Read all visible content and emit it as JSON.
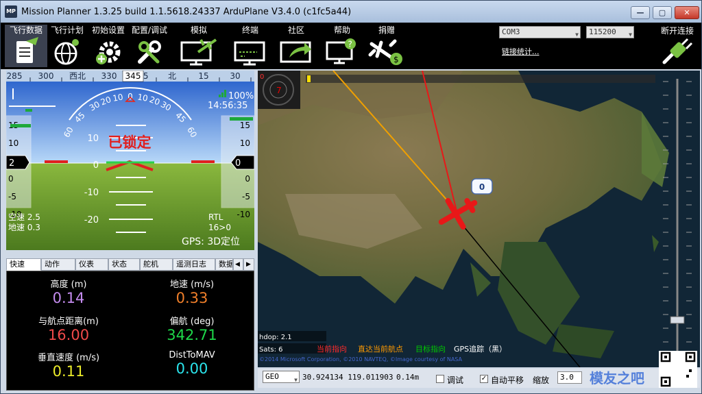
{
  "window": {
    "title": "Mission Planner 1.3.25 build 1.1.5618.24337 ArduPlane V3.4.0 (c1fc5a44)",
    "icon_text": "MP",
    "min": "—",
    "max": "▢",
    "close": "✕"
  },
  "toolbar": {
    "items": [
      {
        "label": "飞行数据",
        "icon": "flight-data-icon"
      },
      {
        "label": "飞行计划",
        "icon": "globe-icon"
      },
      {
        "label": "初始设置",
        "icon": "gear-add-icon"
      },
      {
        "label": "配置/调试",
        "icon": "wrench-icon"
      },
      {
        "label": "模拟",
        "icon": "monitor-plane-icon"
      },
      {
        "label": "终端",
        "icon": "terminal-icon"
      },
      {
        "label": "社区",
        "icon": "share-icon"
      },
      {
        "label": "帮助",
        "icon": "help-monitor-icon"
      },
      {
        "label": "捐赠",
        "icon": "donate-plane-icon"
      }
    ],
    "port": "COM3",
    "baud": "115200",
    "link_stats": "链接统计...",
    "disconnect": "断开连接"
  },
  "hud": {
    "heading_ticks": [
      "285",
      "300",
      "西北",
      "330",
      "345",
      "北",
      "15",
      "30"
    ],
    "heading_value": "345",
    "roll_ticks": [
      "60",
      "45",
      "30",
      "20",
      "10",
      "0",
      "10",
      "20",
      "30",
      "45",
      "60"
    ],
    "pitch_ticks": [
      "10",
      "0",
      "-10",
      "-20"
    ],
    "status": "已锁定",
    "battery": "100%",
    "time": "14:56:35",
    "left_tape": [
      "15",
      "10",
      "5",
      "0",
      "-5",
      "-10"
    ],
    "left_value": "2",
    "right_tape": [
      "15",
      "10",
      "5",
      "0",
      "-5",
      "-10"
    ],
    "right_value": "0",
    "airspeed": "空速 2.5",
    "groundspeed": "地速 0.3",
    "mode": "RTL",
    "wp": "16>0",
    "gps": "GPS: 3D定位",
    "sky_color": "#1a6bd0",
    "ground_color": "#6f9c2a"
  },
  "tabs": [
    "快速",
    "动作",
    "仪表",
    "状态",
    "舵机",
    "遥测日志",
    "数据"
  ],
  "tab_scroll": [
    "◀",
    "▶"
  ],
  "quick": [
    {
      "label": "高度 (m)",
      "value": "0.14",
      "color": "#c58cf0"
    },
    {
      "label": "地速 (m/s)",
      "value": "0.33",
      "color": "#f07f2a"
    },
    {
      "label": "与航点距离(m)",
      "value": "16.00",
      "color": "#f04a4a"
    },
    {
      "label": "偏航 (deg)",
      "value": "342.71",
      "color": "#1ed84a"
    },
    {
      "label": "垂直速度 (m/s)",
      "value": "0.11",
      "color": "#ecec2a"
    },
    {
      "label": "DistToMAV",
      "value": "0.00",
      "color": "#2ae4ec"
    }
  ],
  "map": {
    "wp_label": "0",
    "top_marker": "0",
    "hdop": "hdop: 2.1",
    "sats": "Sats: 6",
    "legend": [
      {
        "text": "当前指向",
        "color": "#ff2a2a"
      },
      {
        "text": "直达当前航点",
        "color": "#ff9a00"
      },
      {
        "text": "目标指向",
        "color": "#00c800"
      },
      {
        "text": "GPS追踪（黑）",
        "color": "#ffffff"
      }
    ],
    "copyright": "©2014 Microsoft Corporation, ©2010 NAVTEQ, ©Image courtesy of NASA",
    "geo": "GEO",
    "coords": "30.924134 119.011903",
    "alt": "0.14m",
    "debug": "调试",
    "autopan": "自动平移",
    "zoom_label": "缩放",
    "zoom_value": "3.0",
    "compass_value": "7"
  },
  "watermark": "模友之吧"
}
